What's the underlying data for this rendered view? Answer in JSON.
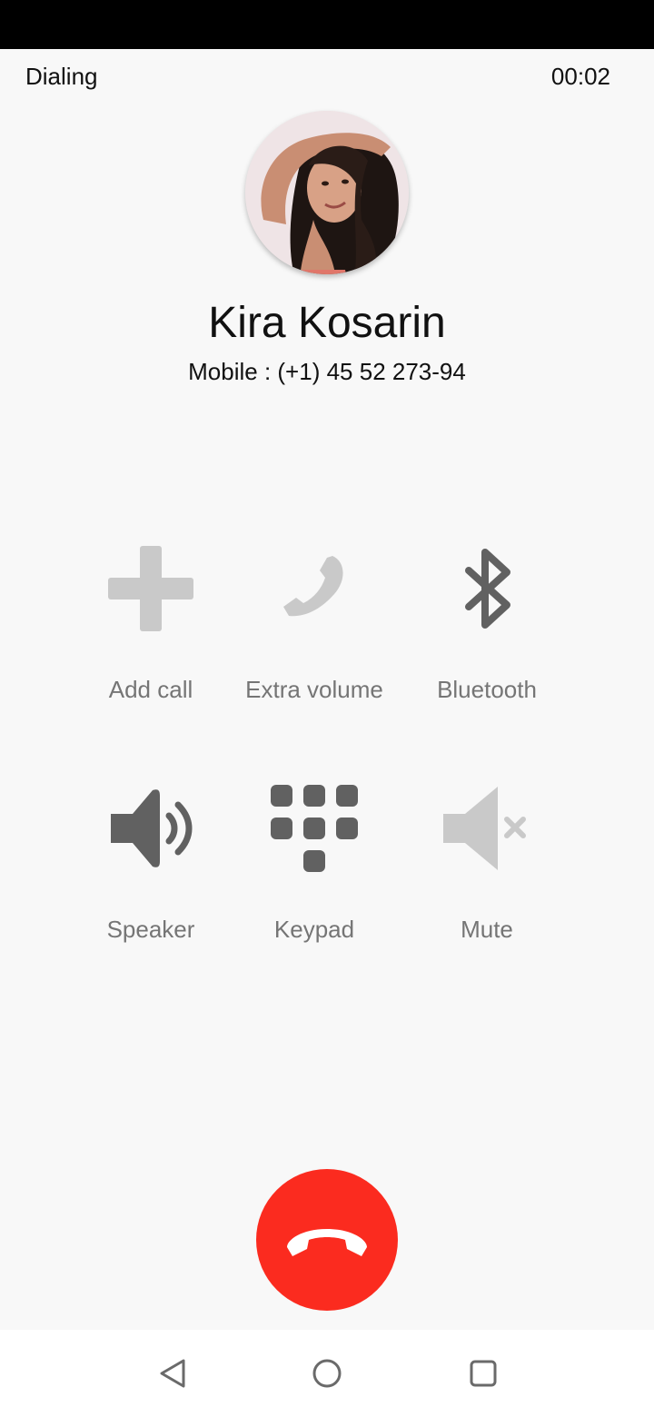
{
  "call": {
    "state": "Dialing",
    "timer": "00:02",
    "contact_name": "Kira Kosarin",
    "contact_number": "Mobile : (+1) 45 52 273-94"
  },
  "actions": [
    {
      "label": "Add call",
      "icon": "add-call-icon",
      "enabled": false
    },
    {
      "label": "Extra volume",
      "icon": "phone-volume-icon",
      "enabled": false
    },
    {
      "label": "Bluetooth",
      "icon": "bluetooth-icon",
      "enabled": true
    },
    {
      "label": "Speaker",
      "icon": "speaker-icon",
      "enabled": true
    },
    {
      "label": "Keypad",
      "icon": "keypad-icon",
      "enabled": true
    },
    {
      "label": "Mute",
      "icon": "mute-icon",
      "enabled": false
    }
  ],
  "colors": {
    "end_call": "#fb2b1f",
    "icon_active": "#616161",
    "icon_disabled": "#c9c9c9",
    "label": "#757575"
  },
  "nav": {
    "back": "back-icon",
    "home": "home-icon",
    "recents": "recents-icon"
  }
}
